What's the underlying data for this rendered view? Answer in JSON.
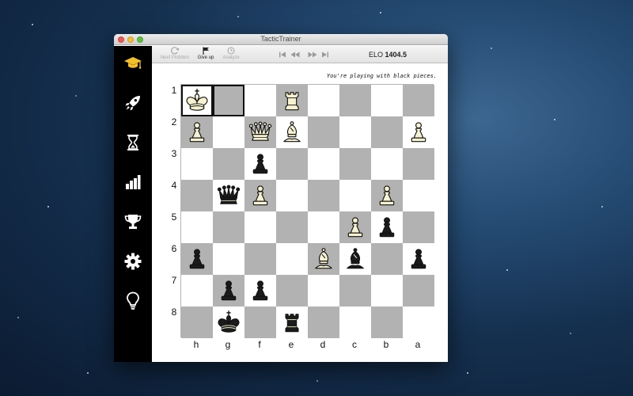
{
  "window": {
    "title": "TacticTrainer"
  },
  "toolbar": {
    "next_problem": "Next Problem",
    "give_up": "Give up",
    "analyze": "Analyze",
    "elo_label": "ELO",
    "elo_value": "1404.5"
  },
  "sidebar": [
    {
      "icon": "graduation-cap-icon"
    },
    {
      "icon": "rocket-icon"
    },
    {
      "icon": "hourglass-icon"
    },
    {
      "icon": "bar-chart-icon"
    },
    {
      "icon": "trophy-icon"
    },
    {
      "icon": "gear-icon"
    },
    {
      "icon": "lightbulb-icon"
    }
  ],
  "board": {
    "hint": "You're playing with black pieces.",
    "ranks": [
      "1",
      "2",
      "3",
      "4",
      "5",
      "6",
      "7",
      "8"
    ],
    "files": [
      "h",
      "g",
      "f",
      "e",
      "d",
      "c",
      "b",
      "a"
    ],
    "highlighted": [
      "h1",
      "g1"
    ],
    "pieces": [
      {
        "square": "h1",
        "piece": "king",
        "color": "white"
      },
      {
        "square": "e1",
        "piece": "rook",
        "color": "white"
      },
      {
        "square": "h2",
        "piece": "pawn",
        "color": "white"
      },
      {
        "square": "f2",
        "piece": "queen",
        "color": "white"
      },
      {
        "square": "e2",
        "piece": "bishop",
        "color": "white"
      },
      {
        "square": "a2",
        "piece": "pawn",
        "color": "white"
      },
      {
        "square": "f3",
        "piece": "pawn",
        "color": "black"
      },
      {
        "square": "g4",
        "piece": "queen",
        "color": "black"
      },
      {
        "square": "f4",
        "piece": "pawn",
        "color": "white"
      },
      {
        "square": "b4",
        "piece": "pawn",
        "color": "white"
      },
      {
        "square": "c5",
        "piece": "pawn",
        "color": "white"
      },
      {
        "square": "b5",
        "piece": "pawn",
        "color": "black"
      },
      {
        "square": "h6",
        "piece": "pawn",
        "color": "black"
      },
      {
        "square": "d6",
        "piece": "bishop",
        "color": "white"
      },
      {
        "square": "c6",
        "piece": "bishop",
        "color": "black"
      },
      {
        "square": "a6",
        "piece": "pawn",
        "color": "black"
      },
      {
        "square": "g7",
        "piece": "pawn",
        "color": "black"
      },
      {
        "square": "f7",
        "piece": "pawn",
        "color": "black"
      },
      {
        "square": "g8",
        "piece": "king",
        "color": "black"
      },
      {
        "square": "e8",
        "piece": "rook",
        "color": "black"
      }
    ]
  },
  "colors": {
    "sidebar_bg": "#000000",
    "sidebar_active": "#f4c02a",
    "sidebar_icon": "#ffffff",
    "square_light": "#ffffff",
    "square_dark": "#b2b2b2",
    "piece_white_fill": "#f6f1d0",
    "piece_black_fill": "#1b1b1b",
    "piece_outline": "#111111"
  }
}
